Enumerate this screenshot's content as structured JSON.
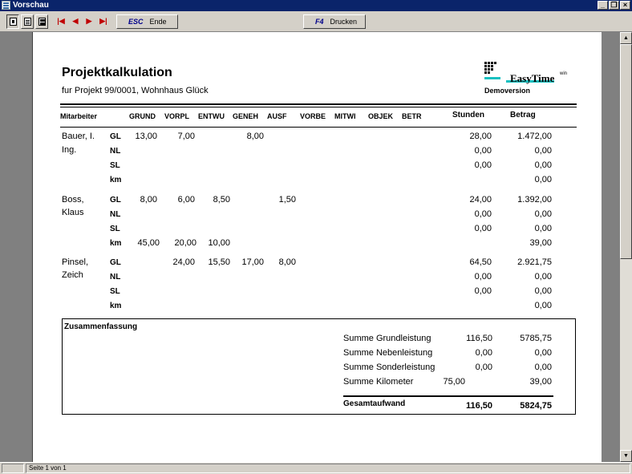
{
  "window": {
    "title": "Vorschau",
    "controls": [
      "_",
      "❐",
      "×"
    ]
  },
  "toolbar": {
    "esc_key": "ESC",
    "esc_label": "Ende",
    "f4_key": "F4",
    "f4_label": "Drucken"
  },
  "report": {
    "title": "Projektkalkulation",
    "subtitle": "fur Projekt 99/0001, Wohnhaus Glück",
    "logo_text": "EasyTime",
    "logo_sup": "win",
    "logo_caption": "Demoversion",
    "columns": {
      "mitarbeiter": "Mitarbeiter",
      "grund": "GRUND",
      "vorpl": "VORPL",
      "entwu": "ENTWU",
      "geneh": "GENEH",
      "ausf": "AUSF",
      "vorbe": "VORBE",
      "mitwi": "MITWI",
      "objek": "OBJEK",
      "betr": "BETR",
      "stunden": "Stunden",
      "betrag": "Betrag"
    },
    "employees": [
      {
        "name_line1": "Bauer, I.",
        "name_line2": "Ing.",
        "rows": [
          {
            "type": "GL",
            "grund": "13,00",
            "vorpl": "7,00",
            "entwu": "",
            "geneh": "8,00",
            "ausf": "",
            "stunden": "28,00",
            "betrag": "1.472,00"
          },
          {
            "type": "NL",
            "grund": "",
            "vorpl": "",
            "entwu": "",
            "geneh": "",
            "ausf": "",
            "stunden": "0,00",
            "betrag": "0,00"
          },
          {
            "type": "SL",
            "grund": "",
            "vorpl": "",
            "entwu": "",
            "geneh": "",
            "ausf": "",
            "stunden": "0,00",
            "betrag": "0,00"
          },
          {
            "type": "km",
            "grund": "",
            "vorpl": "",
            "entwu": "",
            "geneh": "",
            "ausf": "",
            "stunden": "",
            "betrag": "0,00"
          }
        ]
      },
      {
        "name_line1": "Boss,",
        "name_line2": "Klaus",
        "rows": [
          {
            "type": "GL",
            "grund": "8,00",
            "vorpl": "6,00",
            "entwu": "8,50",
            "geneh": "",
            "ausf": "1,50",
            "stunden": "24,00",
            "betrag": "1.392,00"
          },
          {
            "type": "NL",
            "grund": "",
            "vorpl": "",
            "entwu": "",
            "geneh": "",
            "ausf": "",
            "stunden": "0,00",
            "betrag": "0,00"
          },
          {
            "type": "SL",
            "grund": "",
            "vorpl": "",
            "entwu": "",
            "geneh": "",
            "ausf": "",
            "stunden": "0,00",
            "betrag": "0,00"
          },
          {
            "type": "km",
            "grund": "45,00",
            "vorpl": "20,00",
            "entwu": "10,00",
            "geneh": "",
            "ausf": "",
            "stunden": "",
            "betrag": "39,00"
          }
        ]
      },
      {
        "name_line1": "Pinsel,",
        "name_line2": "Zeich",
        "rows": [
          {
            "type": "GL",
            "grund": "",
            "vorpl": "24,00",
            "entwu": "15,50",
            "geneh": "17,00",
            "ausf": "8,00",
            "stunden": "64,50",
            "betrag": "2.921,75"
          },
          {
            "type": "NL",
            "grund": "",
            "vorpl": "",
            "entwu": "",
            "geneh": "",
            "ausf": "",
            "stunden": "0,00",
            "betrag": "0,00"
          },
          {
            "type": "SL",
            "grund": "",
            "vorpl": "",
            "entwu": "",
            "geneh": "",
            "ausf": "",
            "stunden": "0,00",
            "betrag": "0,00"
          },
          {
            "type": "km",
            "grund": "",
            "vorpl": "",
            "entwu": "",
            "geneh": "",
            "ausf": "",
            "stunden": "",
            "betrag": "0,00"
          }
        ]
      }
    ],
    "summary": {
      "title": "Zusammenfassung",
      "rows": [
        {
          "label": "Summe Grundleistung",
          "km": "",
          "stunden": "116,50",
          "betrag": "5785,75"
        },
        {
          "label": "Summe Nebenleistung",
          "km": "",
          "stunden": "0,00",
          "betrag": "0,00"
        },
        {
          "label": "Summe Sonderleistung",
          "km": "",
          "stunden": "0,00",
          "betrag": "0,00"
        },
        {
          "label": "Summe Kilometer",
          "km": "75,00",
          "stunden": "",
          "betrag": "39,00"
        }
      ],
      "total_label": "Gesamtaufwand",
      "total_stunden": "116,50",
      "total_betrag": "5824,75"
    }
  },
  "status": {
    "page_text": "Seite 1 von 1"
  }
}
